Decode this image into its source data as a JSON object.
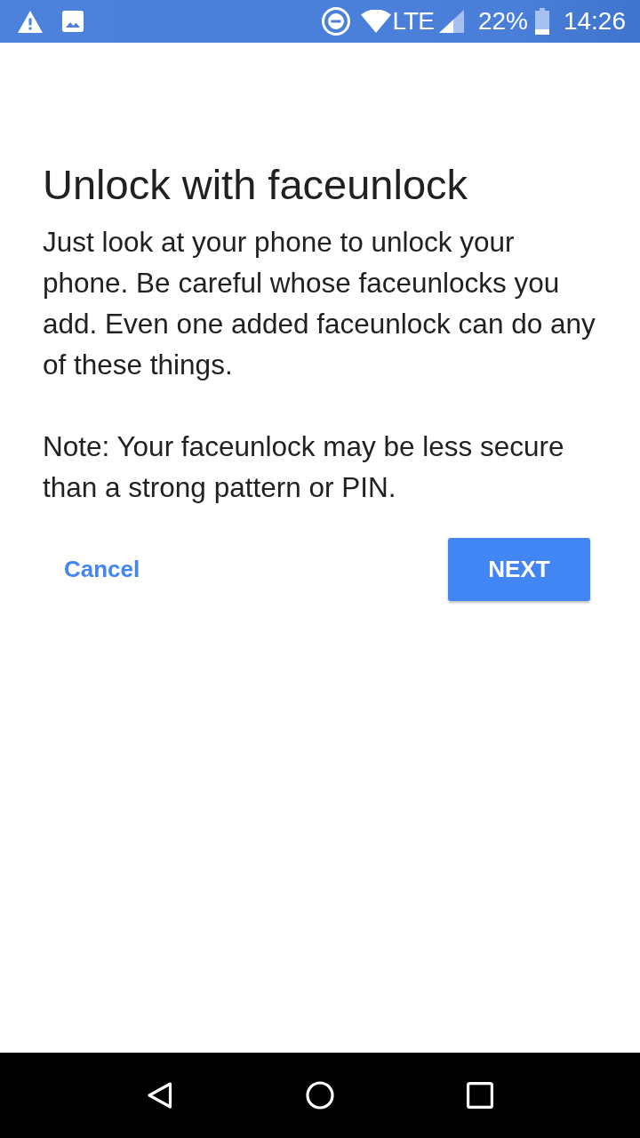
{
  "status_bar": {
    "network": "LTE",
    "battery": "22%",
    "time": "14:26"
  },
  "dialog": {
    "title": "Unlock with faceunlock",
    "paragraphs": [
      "Just look at your phone to unlock your phone. Be careful whose faceunlocks you add. Even one added faceunlock can do any of these things.",
      "Note: Your faceunlock may be less secure than a strong pattern or PIN."
    ]
  },
  "buttons": [
    {
      "kind": "text",
      "label": "Cancel"
    },
    {
      "kind": "raised",
      "label": "NEXT"
    }
  ]
}
